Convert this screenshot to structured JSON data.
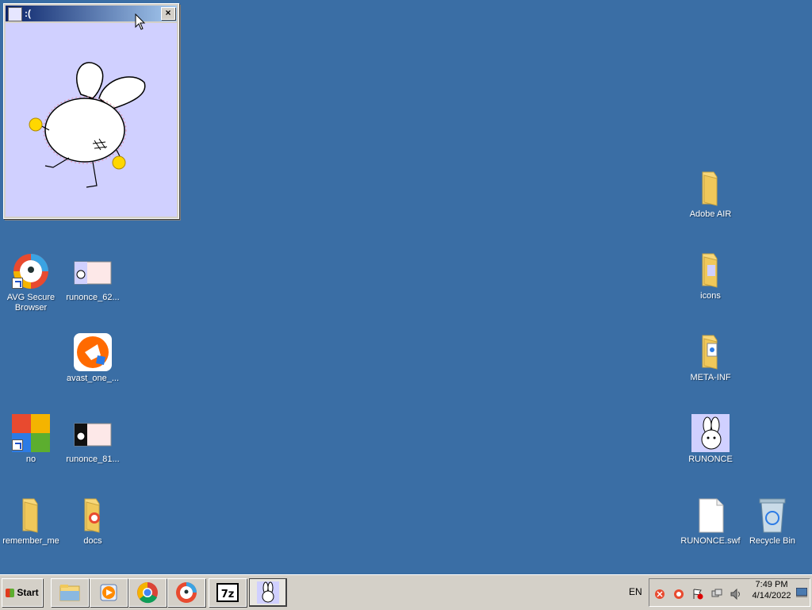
{
  "window": {
    "title": ":("
  },
  "desktop": {
    "left_icons": [
      {
        "label": "AVG Secure\nBrowser",
        "icon": "avg-browser-icon"
      },
      {
        "label": "runonce_62...",
        "icon": "image-file-icon"
      },
      {
        "label": "avast_one_...",
        "icon": "avast-icon"
      },
      {
        "label": "no",
        "icon": "avg-icon"
      },
      {
        "label": "runonce_81...",
        "icon": "image-file-icon"
      },
      {
        "label": "remember_me",
        "icon": "folder-icon"
      },
      {
        "label": "docs",
        "icon": "folder-icon"
      }
    ],
    "right_icons": [
      {
        "label": "Adobe AIR",
        "icon": "folder-icon"
      },
      {
        "label": "icons",
        "icon": "folder-icon"
      },
      {
        "label": "META-INF",
        "icon": "folder-icon"
      },
      {
        "label": "RUNONCE",
        "icon": "bunny-app-icon"
      },
      {
        "label": "RUNONCE.swf",
        "icon": "blank-file-icon"
      },
      {
        "label": "Recycle Bin",
        "icon": "recycle-bin-icon"
      }
    ]
  },
  "taskbar": {
    "start_label": "Start",
    "language": "EN",
    "time": "7:49 PM",
    "date": "4/14/2022",
    "buttons": [
      {
        "name": "file-explorer",
        "icon": "folder-icon"
      },
      {
        "name": "media-player",
        "icon": "media-player-icon"
      },
      {
        "name": "chrome",
        "icon": "chrome-icon"
      },
      {
        "name": "avg-browser",
        "icon": "avg-browser-icon"
      },
      {
        "name": "7zip",
        "icon": "7zip-icon"
      },
      {
        "name": "runonce",
        "icon": "bunny-app-icon"
      }
    ]
  },
  "colors": {
    "desktop": "#3a6ea5",
    "window_content": "#d0d0ff",
    "taskbar": "#d4d0c8"
  }
}
